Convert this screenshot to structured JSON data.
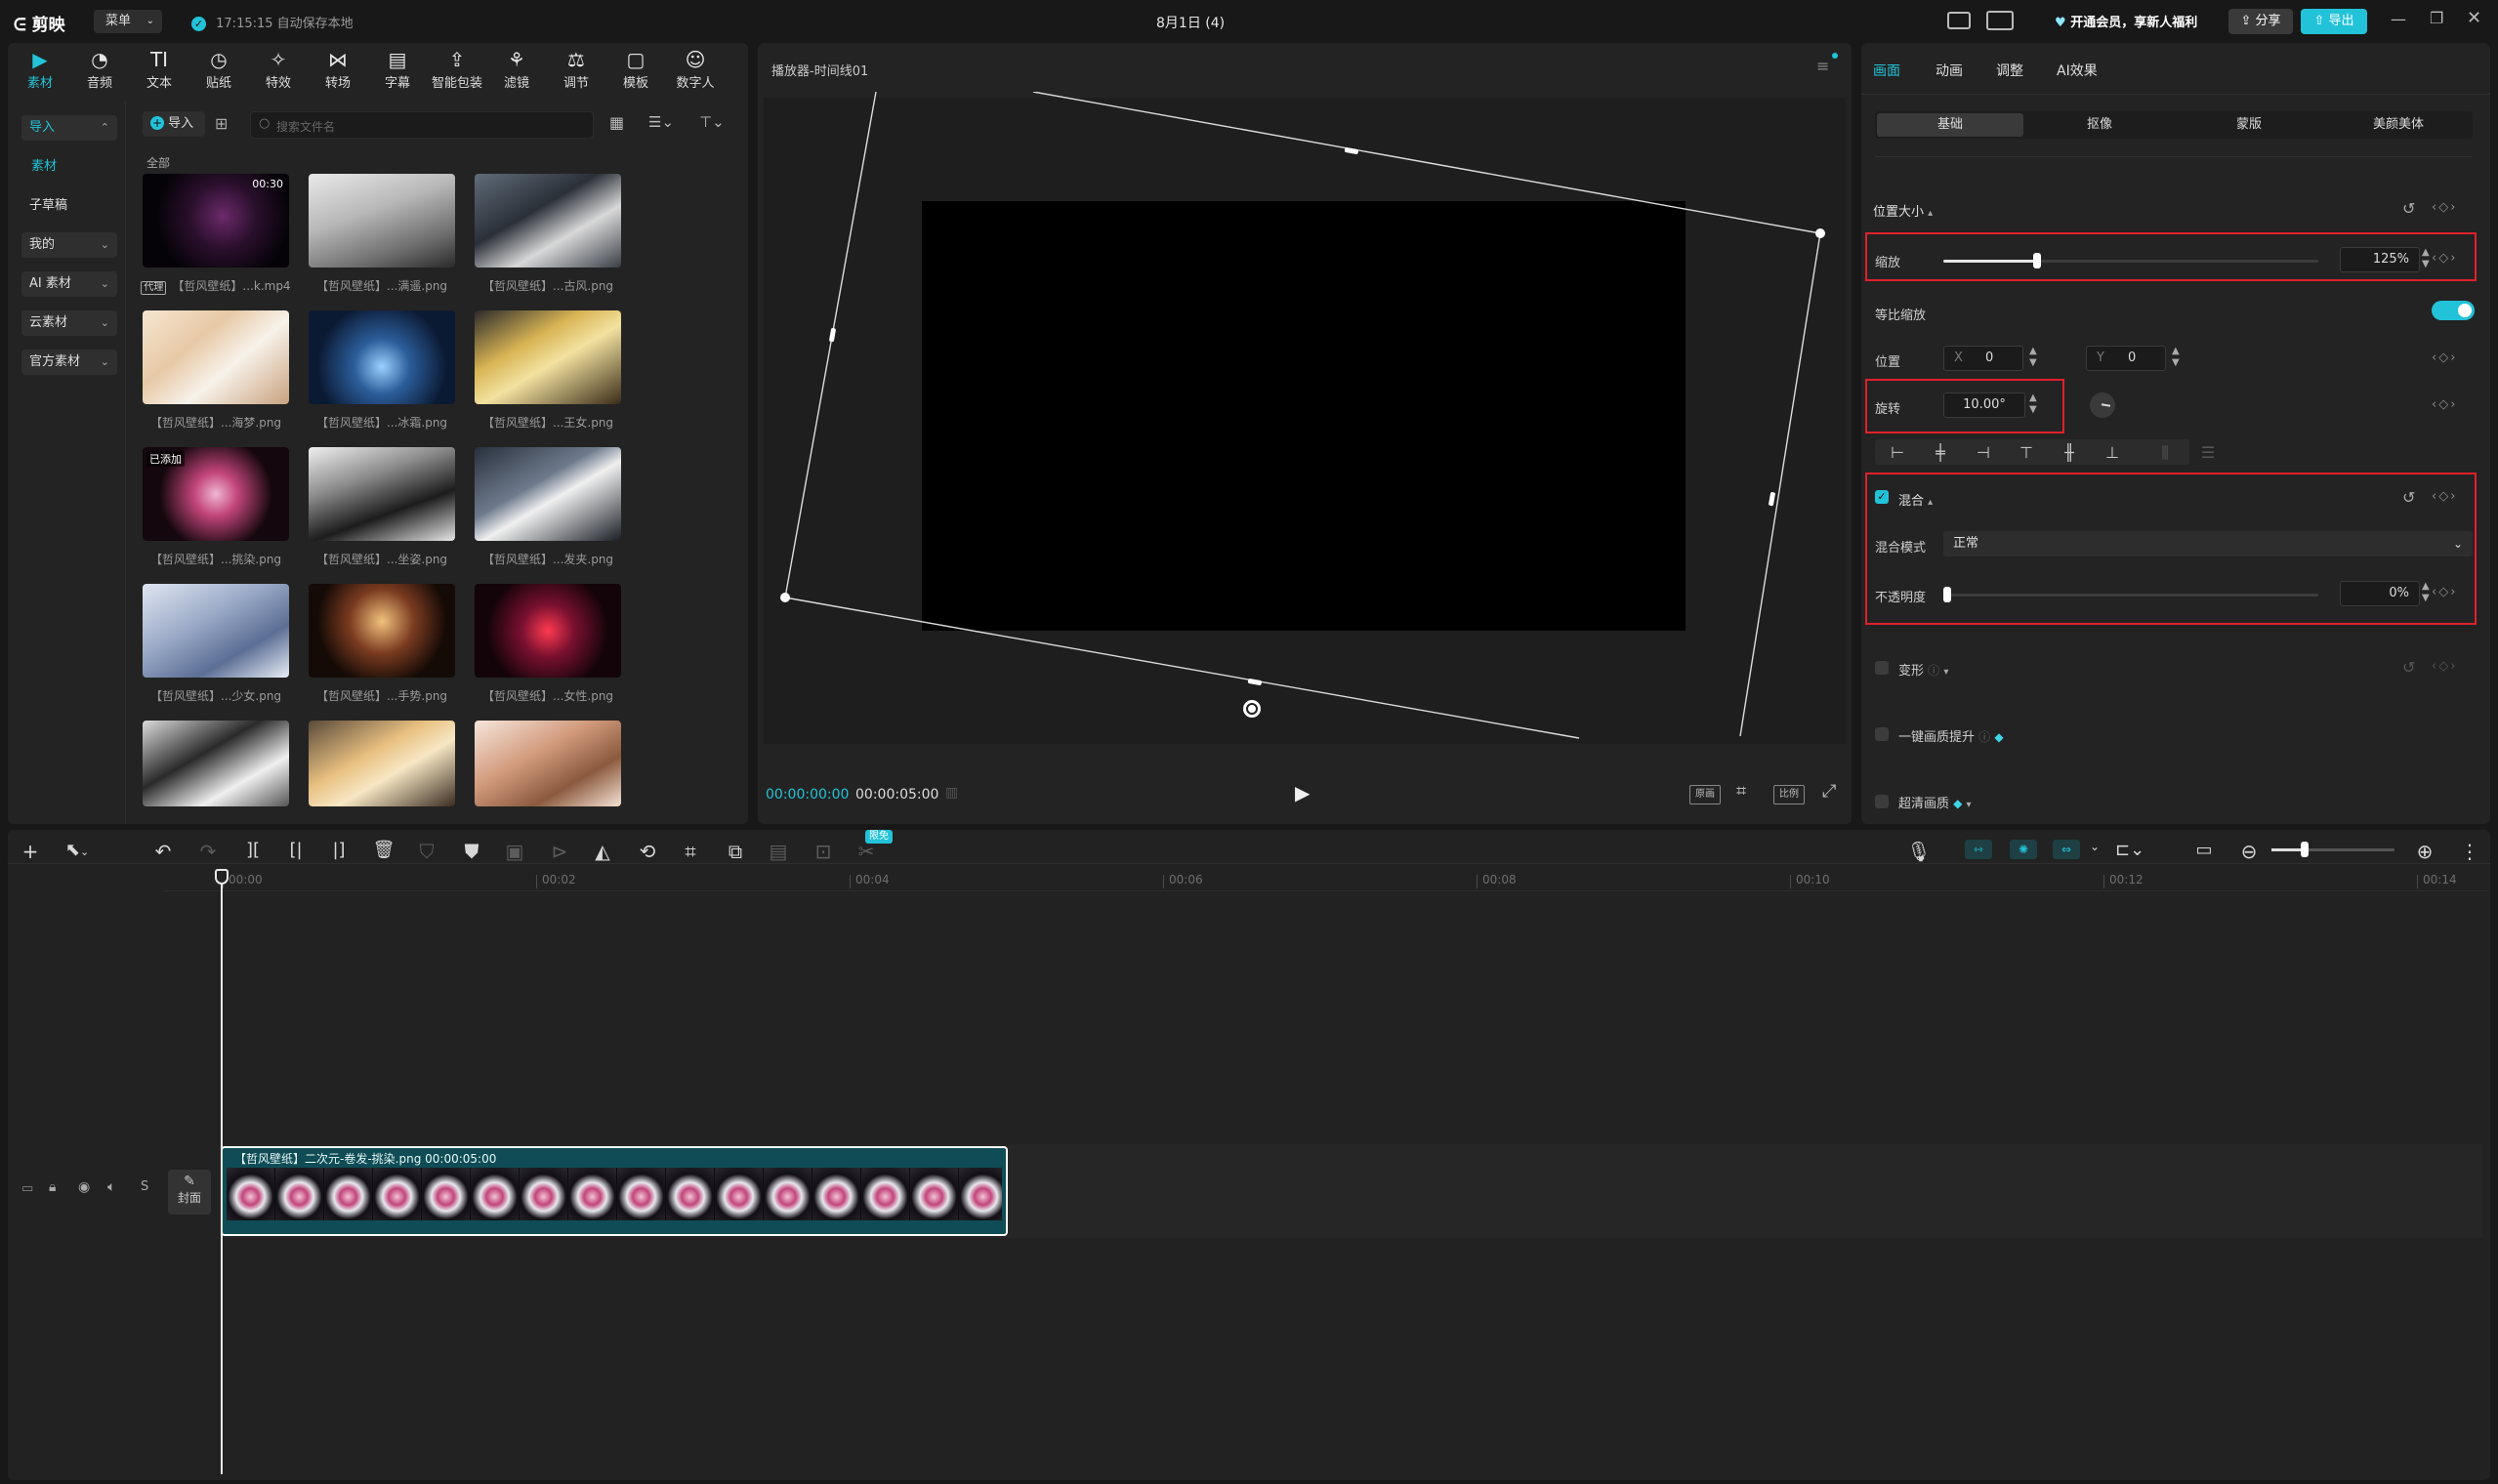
{
  "app": {
    "logo": "剪映",
    "menu_label": "菜单",
    "autosave": "17:15:15 自动保存本地",
    "project_title": "8月1日 (4)",
    "vip_promo": "开通会员，享新人福利",
    "share_label": "分享",
    "export_label": "导出"
  },
  "toolbar_top": [
    {
      "label": "素材",
      "icon": "media-icon"
    },
    {
      "label": "音频",
      "icon": "audio-icon"
    },
    {
      "label": "文本",
      "icon": "text-icon"
    },
    {
      "label": "贴纸",
      "icon": "sticker-icon"
    },
    {
      "label": "特效",
      "icon": "effects-icon"
    },
    {
      "label": "转场",
      "icon": "transition-icon"
    },
    {
      "label": "字幕",
      "icon": "subtitle-icon"
    },
    {
      "label": "智能包装",
      "icon": "smart-pack-icon"
    },
    {
      "label": "滤镜",
      "icon": "filter-icon"
    },
    {
      "label": "调节",
      "icon": "adjust-icon"
    },
    {
      "label": "模板",
      "icon": "template-icon"
    },
    {
      "label": "数字人",
      "icon": "avatar-icon"
    }
  ],
  "media_sidebar": {
    "import": "导入",
    "material": "素材",
    "sub_draft": "子草稿",
    "mine": "我的",
    "ai_material": "AI 素材",
    "cloud": "云素材",
    "official": "官方素材"
  },
  "media_panel": {
    "import_button": "导入",
    "search_placeholder": "搜索文件名",
    "group_label": "全部",
    "items": [
      {
        "caption": "【哲风壁纸】...k.mp4",
        "badge": "代理",
        "duration": "00:30"
      },
      {
        "caption": "【哲风壁纸】...满遥.png"
      },
      {
        "caption": "【哲风壁纸】...古风.png"
      },
      {
        "caption": "【哲风壁纸】...海梦.png"
      },
      {
        "caption": "【哲风壁纸】...冰霜.png"
      },
      {
        "caption": "【哲风壁纸】...王女.png"
      },
      {
        "caption": "【哲风壁纸】...挑染.png",
        "added": "已添加"
      },
      {
        "caption": "【哲风壁纸】...坐姿.png"
      },
      {
        "caption": "【哲风壁纸】...发夹.png"
      },
      {
        "caption": "【哲风壁纸】...少女.png"
      },
      {
        "caption": "【哲风壁纸】...手势.png"
      },
      {
        "caption": "【哲风壁纸】...女性.png"
      },
      {
        "caption": ""
      },
      {
        "caption": ""
      },
      {
        "caption": ""
      }
    ]
  },
  "player": {
    "title": "播放器-时间线01",
    "current_time": "00:00:00:00",
    "total_time": "00:00:05:00",
    "btn_proxy": "原画",
    "btn_ratio": "比例"
  },
  "inspector": {
    "tabs": [
      "画面",
      "动画",
      "调整",
      "AI效果"
    ],
    "subtabs": [
      "基础",
      "抠像",
      "蒙版",
      "美颜美体"
    ],
    "section_position": "位置大小",
    "scale_label": "缩放",
    "scale_value": "125%",
    "scale_fraction": 0.25,
    "uniform_scale_label": "等比缩放",
    "position_label": "位置",
    "x_label": "X",
    "x_value": "0",
    "y_label": "Y",
    "y_value": "0",
    "rotate_label": "旋转",
    "rotate_value": "10.00°",
    "section_blend": "混合",
    "blend_mode_label": "混合模式",
    "blend_mode_value": "正常",
    "opacity_label": "不透明度",
    "opacity_value": "0%",
    "section_deform": "变形",
    "section_enhance": "一键画质提升",
    "section_superres": "超清画质"
  },
  "timeline": {
    "limited_badge": "限免",
    "ruler": [
      "00:00",
      "00:02",
      "00:04",
      "00:06",
      "00:08",
      "00:10",
      "00:12",
      "00:14"
    ],
    "clip_label": "【哲风壁纸】二次元-卷发-挑染.png  00:00:05:00",
    "cover_label": "封面"
  },
  "colors": {
    "accent": "#22c3d8",
    "highlight_box": "#e0202a",
    "clip_bg": "#0f4c55"
  }
}
